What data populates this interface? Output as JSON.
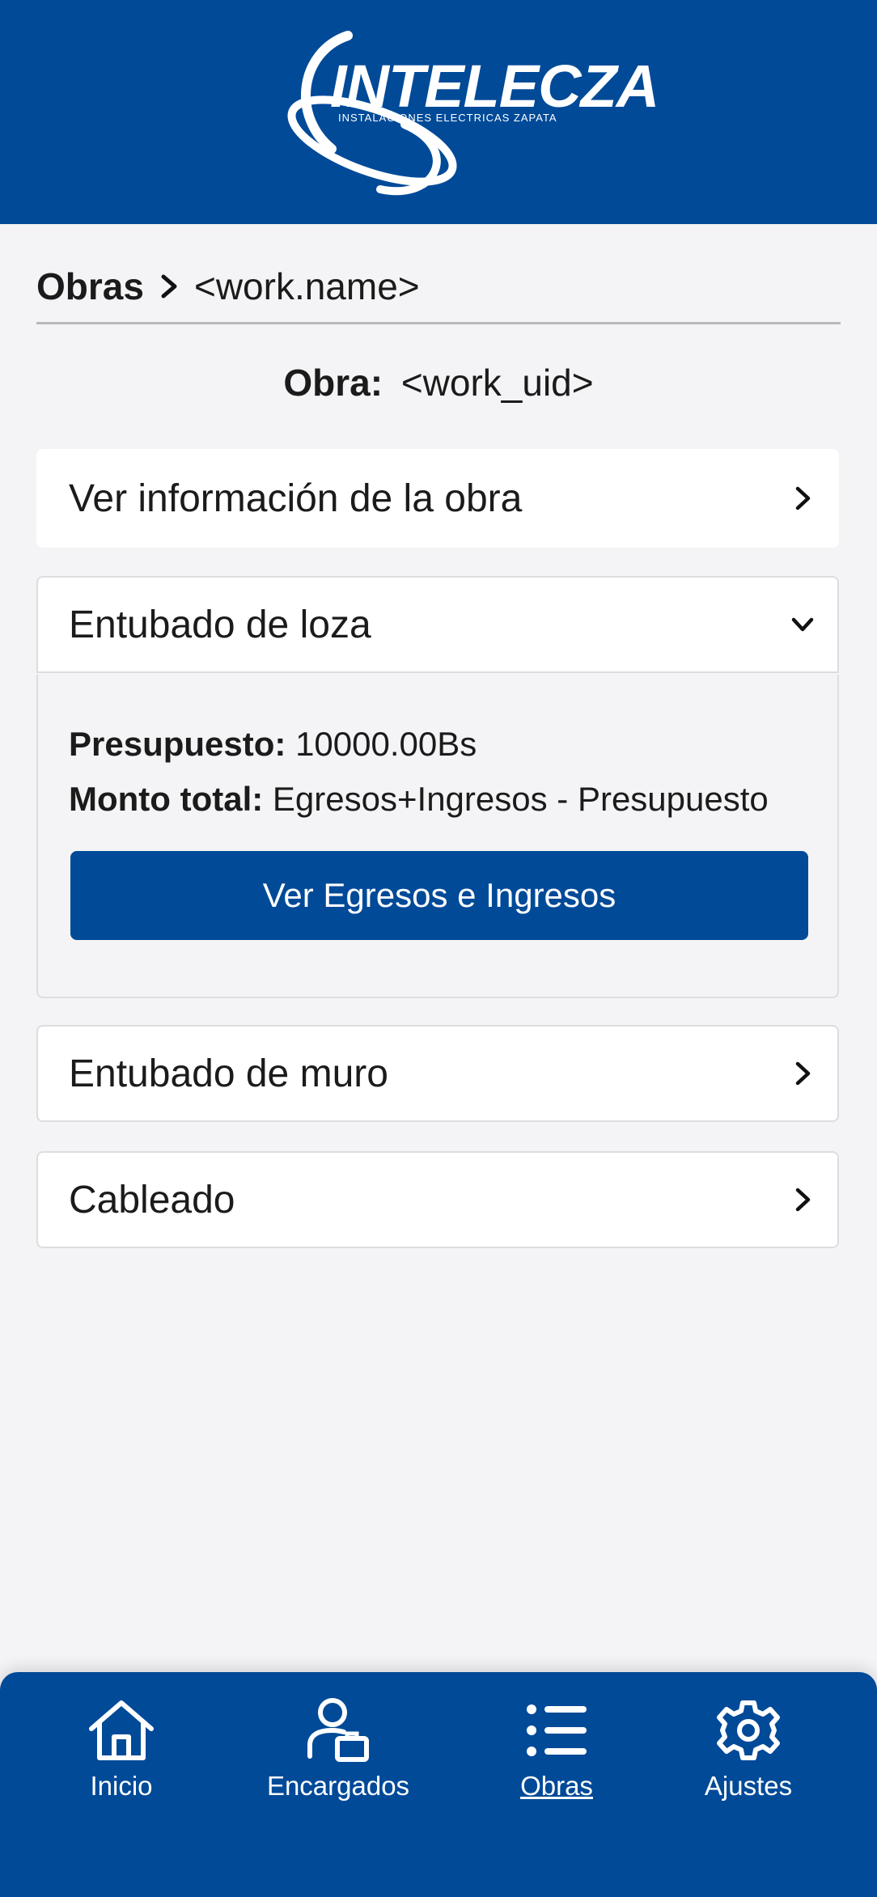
{
  "header": {
    "logo_text": "INTELECZA",
    "logo_subtitle": "INSTALACIONES ELECTRICAS ZAPATA"
  },
  "breadcrumb": {
    "root": "Obras",
    "current": "<work.name>"
  },
  "work": {
    "title_label": "Obra:",
    "title_value": "<work_uid>"
  },
  "items": {
    "info": "Ver información de la obra",
    "loza": "Entubado de loza",
    "muro": "Entubado de muro",
    "cableado": "Cableado"
  },
  "loza_detail": {
    "budget_label": "Presupuesto:",
    "budget_value": "10000.00Bs",
    "total_label": "Monto total:",
    "total_value": "Egresos+Ingresos - Presupuesto",
    "button_label": "Ver Egresos e Ingresos"
  },
  "nav": {
    "items": [
      {
        "label": "Inicio",
        "icon": "home-icon"
      },
      {
        "label": "Encargados",
        "icon": "manager-icon"
      },
      {
        "label": "Obras",
        "icon": "list-icon",
        "active": true
      },
      {
        "label": "Ajustes",
        "icon": "gear-icon"
      }
    ]
  },
  "colors": {
    "brand_blue": "#004a98",
    "background": "#f4f4f6",
    "card_border": "#dddde0"
  }
}
